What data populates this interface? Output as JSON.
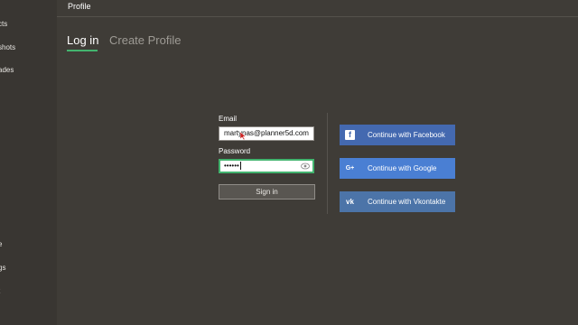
{
  "header": {
    "title": "Profile"
  },
  "sidebar": {
    "items": [
      {
        "label": "cts"
      },
      {
        "label": "shots"
      },
      {
        "label": "ades"
      },
      {
        "label": "e"
      },
      {
        "label": "gs"
      },
      {
        "label": "t"
      }
    ]
  },
  "tabs": [
    {
      "label": "Log in",
      "active": true
    },
    {
      "label": "Create Profile",
      "active": false
    }
  ],
  "login": {
    "email_label": "Email",
    "email_value": "martynas@planner5d.com",
    "password_label": "Password",
    "password_mask": "••••••",
    "signin_label": "Sign in"
  },
  "social": [
    {
      "label": "Continue with Facebook",
      "icon": "facebook-icon",
      "glyph": "f",
      "color": "#4469b0"
    },
    {
      "label": "Continue with Google",
      "icon": "google-plus-icon",
      "glyph": "G+",
      "color": "#4a7fd3"
    },
    {
      "label": "Continue with Vkontakte",
      "icon": "vkontakte-icon",
      "glyph": "vk",
      "color": "#4c74a8"
    }
  ],
  "colors": {
    "accent": "#43b46f",
    "background": "#3f3c37",
    "sidebar": "#393632"
  }
}
